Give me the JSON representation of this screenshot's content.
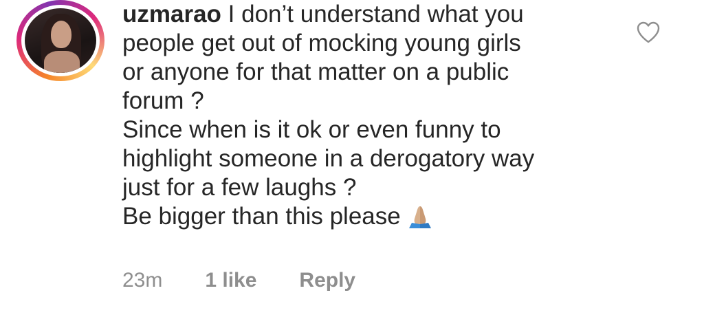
{
  "comment": {
    "username": "uzmarao",
    "lines": [
      " I don’t understand what you",
      "people get out of mocking young girls",
      "or anyone for that matter on a public",
      "forum ?",
      "Since when is it ok or even funny to",
      "highlight someone in a derogatory way",
      "just for a few laughs ?",
      "Be bigger than this please"
    ],
    "emoji": "folded-hands-emoji",
    "time": "23m",
    "likes": "1 like",
    "reply_label": "Reply",
    "like_icon": "heart-outline-icon"
  },
  "colors": {
    "text": "#262626",
    "muted": "#8e8e8e",
    "ring_start": "#f58529",
    "ring_end": "#dd2a7b"
  }
}
